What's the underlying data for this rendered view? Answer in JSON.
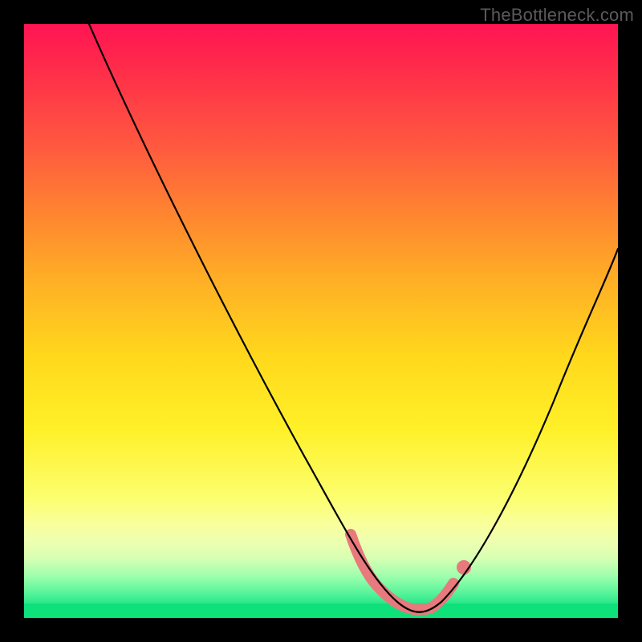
{
  "watermark": "TheBottleneck.com",
  "chart_data": {
    "type": "line",
    "title": "",
    "xlabel": "",
    "ylabel": "",
    "xlim": [
      0,
      100
    ],
    "ylim": [
      0,
      100
    ],
    "note": "Bottleneck curve. Y approximates bottleneck percentage (high=red/bad, low=green/good). X is an implicit component-balance axis. Values are estimated from the rendered curve.",
    "series": [
      {
        "name": "bottleneck_curve",
        "x": [
          11,
          15,
          20,
          25,
          30,
          35,
          40,
          45,
          50,
          55,
          57,
          60,
          63,
          65,
          68,
          70,
          73,
          77,
          80,
          85,
          90,
          95,
          100
        ],
        "values": [
          100,
          92,
          83,
          73,
          64,
          54,
          45,
          35,
          25,
          14,
          9,
          5,
          2,
          1,
          2,
          3,
          6,
          13,
          19,
          30,
          41,
          52,
          62
        ]
      },
      {
        "name": "optimal_zone_highlight",
        "x": [
          55,
          57,
          60,
          63,
          65,
          68,
          70,
          73
        ],
        "values": [
          14,
          9,
          5,
          2,
          1,
          2,
          3,
          6
        ]
      }
    ],
    "colors": {
      "curve": "#000000",
      "highlight": "#e8797c",
      "gradient_top": "#ff1452",
      "gradient_mid": "#ffd81c",
      "gradient_bottom": "#0ee07a"
    }
  }
}
